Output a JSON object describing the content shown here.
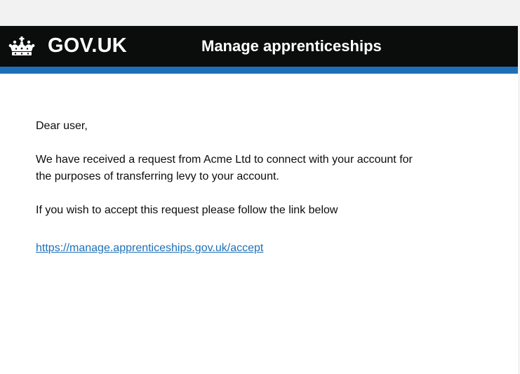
{
  "header": {
    "logotype": "GOV.UK",
    "service_name": "Manage apprenticeships"
  },
  "email": {
    "greeting": "Dear user,",
    "paragraph_1": "We have received a request from Acme Ltd to connect with your account for the purposes of transferring levy to your account.",
    "paragraph_2": "If you wish to accept this request please follow the link below",
    "link_text": "https://manage.apprenticeships.gov.uk/accept"
  },
  "colors": {
    "header_background": "#0b0c0c",
    "header_rule": "#1d70b8",
    "link": "#1d70b8",
    "text": "#0b0c0c"
  },
  "icons": {
    "crown": "crown-icon"
  }
}
